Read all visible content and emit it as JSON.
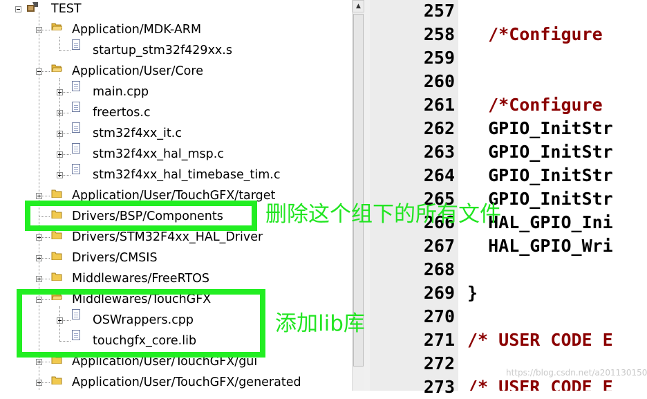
{
  "tree": {
    "root_label": "TEST",
    "items": [
      {
        "label": "Application/MDK-ARM",
        "kind": "folder",
        "state": "expanded"
      },
      {
        "label": "startup_stm32f429xx.s",
        "kind": "file",
        "state": "leaf"
      },
      {
        "label": "Application/User/Core",
        "kind": "folder",
        "state": "expanded"
      },
      {
        "label": "main.cpp",
        "kind": "file",
        "state": "collapsed"
      },
      {
        "label": "freertos.c",
        "kind": "file",
        "state": "collapsed"
      },
      {
        "label": "stm32f4xx_it.c",
        "kind": "file",
        "state": "collapsed"
      },
      {
        "label": "stm32f4xx_hal_msp.c",
        "kind": "file",
        "state": "collapsed"
      },
      {
        "label": "stm32f4xx_hal_timebase_tim.c",
        "kind": "file",
        "state": "collapsed"
      },
      {
        "label": "Application/User/TouchGFX/target",
        "kind": "folder",
        "state": "collapsed"
      },
      {
        "label": "Drivers/BSP/Components",
        "kind": "folder",
        "state": "empty"
      },
      {
        "label": "Drivers/STM32F4xx_HAL_Driver",
        "kind": "folder",
        "state": "collapsed"
      },
      {
        "label": "Drivers/CMSIS",
        "kind": "folder",
        "state": "collapsed"
      },
      {
        "label": "Middlewares/FreeRTOS",
        "kind": "folder",
        "state": "collapsed"
      },
      {
        "label": "Middlewares/TouchGFX",
        "kind": "folder",
        "state": "expanded"
      },
      {
        "label": "OSWrappers.cpp",
        "kind": "file",
        "state": "collapsed"
      },
      {
        "label": "touchgfx_core.lib",
        "kind": "file",
        "state": "leaf"
      },
      {
        "label": "Application/User/TouchGFX/gui",
        "kind": "folder",
        "state": "collapsed"
      },
      {
        "label": "Application/User/TouchGFX/generated",
        "kind": "folder",
        "state": "collapsed"
      }
    ]
  },
  "editor": {
    "line_numbers": [
      "257",
      "258",
      "259",
      "260",
      "261",
      "262",
      "263",
      "264",
      "265",
      "266",
      "267",
      "268",
      "269",
      "270",
      "271",
      "272",
      "273"
    ],
    "lines": [
      {
        "text": "",
        "style": "normal"
      },
      {
        "text": "  /*Configure",
        "style": "comment"
      },
      {
        "text": "",
        "style": "normal"
      },
      {
        "text": "",
        "style": "normal"
      },
      {
        "text": "  /*Configure",
        "style": "comment"
      },
      {
        "text": "  GPIO_InitStr",
        "style": "normal"
      },
      {
        "text": "  GPIO_InitStr",
        "style": "normal"
      },
      {
        "text": "  GPIO_InitStr",
        "style": "normal"
      },
      {
        "text": "  GPIO_InitStr",
        "style": "normal"
      },
      {
        "text": "  HAL_GPIO_Ini",
        "style": "normal"
      },
      {
        "text": "  HAL_GPIO_Wri",
        "style": "normal"
      },
      {
        "text": "",
        "style": "normal"
      },
      {
        "text": "}",
        "style": "normal"
      },
      {
        "text": "",
        "style": "normal"
      },
      {
        "text": "/* USER CODE E",
        "style": "comment"
      },
      {
        "text": "",
        "style": "normal"
      },
      {
        "text": "/* USER CODE E",
        "style": "comment"
      }
    ]
  },
  "annotations": {
    "delete_note": "删除这个组下的所有文件",
    "add_note": "添加lib库",
    "color": "#22ee22"
  },
  "watermark": "https://blog.csdn.net/a2011301506",
  "icons": {
    "root": "project-root-icon",
    "folder": "folder-icon",
    "file": "file-icon",
    "expander": "expand-collapse-icon",
    "scroll_up": "scroll-up-arrow-icon"
  }
}
